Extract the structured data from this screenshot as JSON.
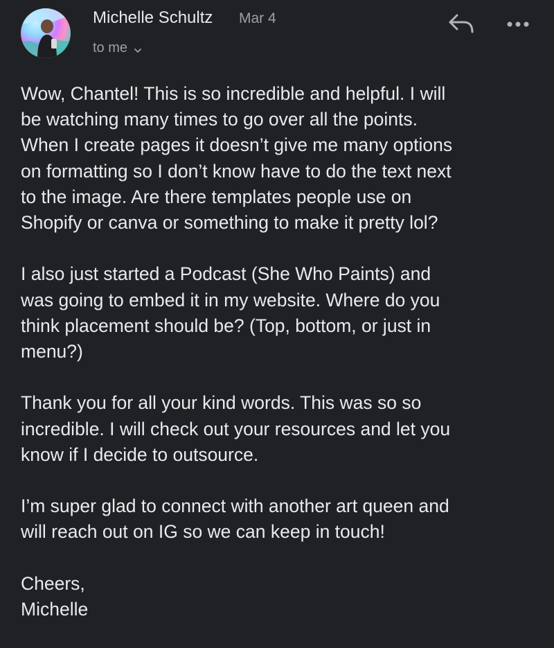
{
  "sender": {
    "name": "Michelle Schultz",
    "date": "Mar 4",
    "recipient_label": "to me",
    "avatar_icon": "avatar-photo"
  },
  "actions": {
    "reply_icon": "reply-icon",
    "more_icon": "more-options-icon"
  },
  "message": {
    "paragraphs": [
      {
        "lines": [
          "Wow, Chantel! This is so incredible and helpful. I will",
          "be watching many times to go over all the points.",
          "When I create pages it doesn’t give me many options",
          "on formatting so I don’t know have to do the text next",
          "to the image. Are there templates people use on",
          "Shopify or canva or something to make it pretty lol?"
        ]
      },
      {
        "lines": [
          "I also just started a Podcast (She Who Paints) and",
          "was going to embed it in my website. Where do you",
          "think placement should be? (Top, bottom, or just in",
          "menu?)"
        ]
      },
      {
        "lines": [
          "Thank you for all your kind words. This was so so",
          "incredible. I will check out your resources and let you",
          "know if I decide to outsource."
        ]
      },
      {
        "lines": [
          "I’m super glad to connect with another art queen and",
          "will reach out on IG so we can keep in touch!"
        ]
      },
      {
        "lines": [
          "Cheers,",
          "Michelle"
        ]
      }
    ]
  },
  "colors": {
    "background": "#202124",
    "primary_text": "#e8eaed",
    "secondary_text": "#9aa0a6"
  }
}
